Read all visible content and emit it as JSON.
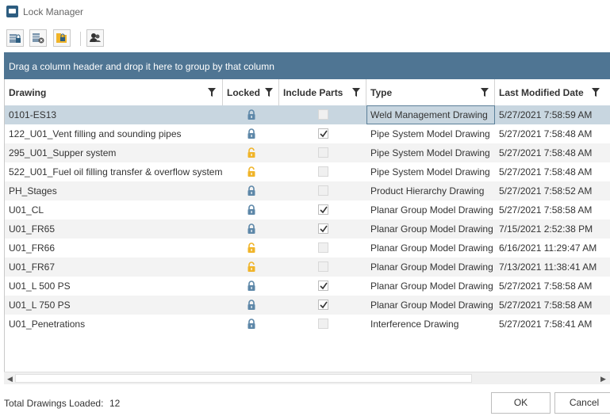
{
  "window": {
    "title": "Lock Manager"
  },
  "toolbar": {
    "buttons": [
      {
        "name": "lock-drawing",
        "icon": "lock-grid-icon"
      },
      {
        "name": "unlock-drawing",
        "icon": "unlock-grid-icon"
      },
      {
        "name": "folder-lock",
        "icon": "folder-lock-icon"
      },
      {
        "name": "users",
        "icon": "users-icon"
      }
    ]
  },
  "group_panel": {
    "text": "Drag a column header and drop it here to group by that column"
  },
  "columns": [
    "Drawing",
    "Locked",
    "Include Parts",
    "Type",
    "Last Modified Date"
  ],
  "rows": [
    {
      "drawing": "0101-ES13",
      "locked": "blue",
      "include_parts": "disabled",
      "type": "Weld Management Drawing",
      "date": "5/27/2021 7:58:59 AM"
    },
    {
      "drawing": "122_U01_Vent filling and sounding pipes",
      "locked": "blue",
      "include_parts": "checked",
      "type": "Pipe System Model Drawing",
      "date": "5/27/2021 7:58:48 AM"
    },
    {
      "drawing": "295_U01_Supper system",
      "locked": "yellow",
      "include_parts": "disabled",
      "type": "Pipe System Model Drawing",
      "date": "5/27/2021 7:58:48 AM"
    },
    {
      "drawing": "522_U01_Fuel oil filling transfer & overflow system",
      "locked": "yellow",
      "include_parts": "disabled",
      "type": "Pipe System Model Drawing",
      "date": "5/27/2021 7:58:48 AM"
    },
    {
      "drawing": "PH_Stages",
      "locked": "blue",
      "include_parts": "disabled",
      "type": "Product Hierarchy Drawing",
      "date": "5/27/2021 7:58:52 AM"
    },
    {
      "drawing": "U01_CL",
      "locked": "blue",
      "include_parts": "checked",
      "type": "Planar Group Model Drawing",
      "date": "5/27/2021 7:58:58 AM"
    },
    {
      "drawing": "U01_FR65",
      "locked": "blue",
      "include_parts": "checked",
      "type": "Planar Group Model Drawing",
      "date": "7/15/2021 2:52:38 PM"
    },
    {
      "drawing": "U01_FR66",
      "locked": "yellow",
      "include_parts": "disabled",
      "type": "Planar Group Model Drawing",
      "date": "6/16/2021 11:29:47 AM"
    },
    {
      "drawing": "U01_FR67",
      "locked": "yellow",
      "include_parts": "disabled",
      "type": "Planar Group Model Drawing",
      "date": "7/13/2021 11:38:41 AM"
    },
    {
      "drawing": "U01_L 500 PS",
      "locked": "blue",
      "include_parts": "checked",
      "type": "Planar Group Model Drawing",
      "date": "5/27/2021 7:58:58 AM"
    },
    {
      "drawing": "U01_L 750 PS",
      "locked": "blue",
      "include_parts": "checked",
      "type": "Planar Group Model Drawing",
      "date": "5/27/2021 7:58:58 AM"
    },
    {
      "drawing": "U01_Penetrations",
      "locked": "blue",
      "include_parts": "disabled",
      "type": "Interference Drawing",
      "date": "5/27/2021 7:58:41 AM"
    }
  ],
  "selected_row": 0,
  "footer": {
    "label": "Total Drawings Loaded:",
    "count": "12"
  },
  "buttons": {
    "ok": "OK",
    "cancel": "Cancel"
  },
  "colors": {
    "header_bar": "#4f7593",
    "lock_blue": "#5d87a8",
    "lock_yellow": "#f0b429",
    "selected_row": "#c8d6e0"
  }
}
